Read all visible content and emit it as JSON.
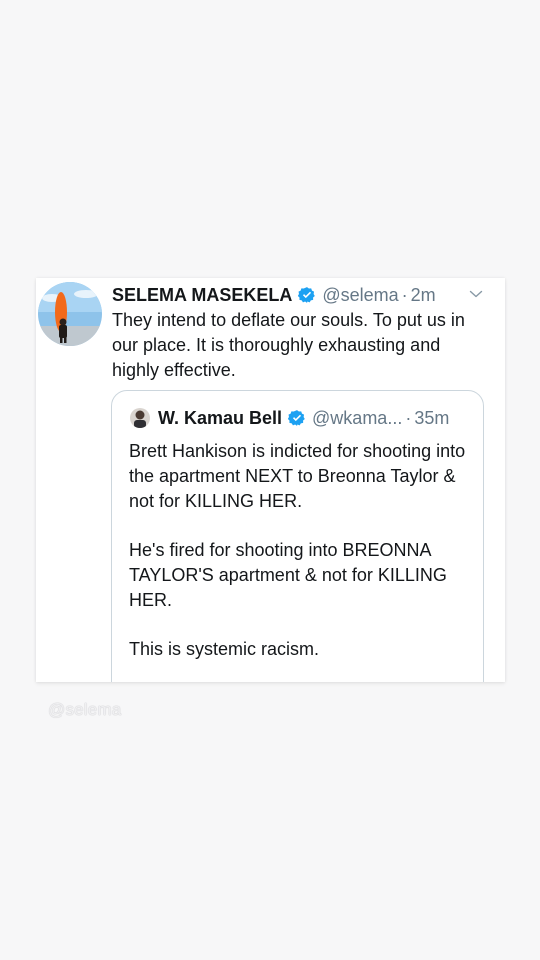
{
  "tweet": {
    "author_name": "SELEMA MASEKELA",
    "handle": "@selema",
    "separator": "·",
    "time": "2m",
    "avatar_icon": "profile-photo-surfboard",
    "text": "They intend to deflate our souls. To put us in our place. It is thoroughly exhausting and highly effective."
  },
  "quoted_tweet": {
    "author_name": "W. Kamau Bell",
    "handle": "@wkama...",
    "separator": "·",
    "time": "35m",
    "paragraphs": [
      "Brett Hankison is indicted for shooting into the apartment NEXT to Breonna Taylor & not for KILLING HER.",
      "He's fired for shooting into BREONNA TAYLOR'S apartment & not for KILLING HER.",
      "This is systemic racism."
    ]
  },
  "watermark": "@selema",
  "colors": {
    "verified": "#1da1f2",
    "secondary_text": "#657786",
    "primary_text": "#14171a",
    "border": "#ccd6dd"
  }
}
